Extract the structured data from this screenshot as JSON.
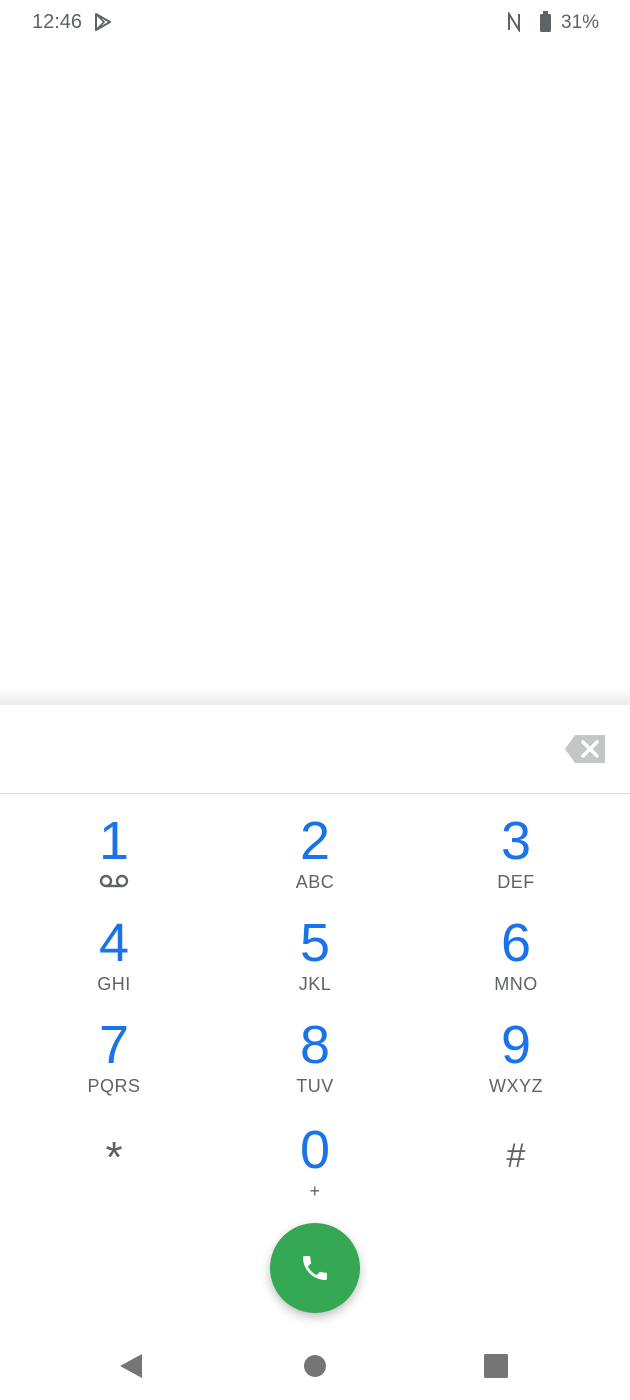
{
  "status_bar": {
    "time": "12:46",
    "battery": "31%",
    "icons": [
      "play-store-icon",
      "nfc-icon",
      "battery-icon"
    ]
  },
  "dialpad": {
    "digits_value": "",
    "keys": [
      {
        "digit": "1",
        "letters": "",
        "icon": "voicemail-icon"
      },
      {
        "digit": "2",
        "letters": "ABC"
      },
      {
        "digit": "3",
        "letters": "DEF"
      },
      {
        "digit": "4",
        "letters": "GHI"
      },
      {
        "digit": "5",
        "letters": "JKL"
      },
      {
        "digit": "6",
        "letters": "MNO"
      },
      {
        "digit": "7",
        "letters": "PQRS"
      },
      {
        "digit": "8",
        "letters": "TUV"
      },
      {
        "digit": "9",
        "letters": "WXYZ"
      },
      {
        "digit": "*",
        "letters": ""
      },
      {
        "digit": "0",
        "letters": "+"
      },
      {
        "digit": "#",
        "letters": ""
      }
    ]
  },
  "colors": {
    "accent": "#1a73e8",
    "call_button": "#34a853",
    "secondary_text": "#5f6368"
  },
  "nav_bar": {
    "icons": [
      "back-icon",
      "home-icon",
      "recents-icon"
    ]
  }
}
